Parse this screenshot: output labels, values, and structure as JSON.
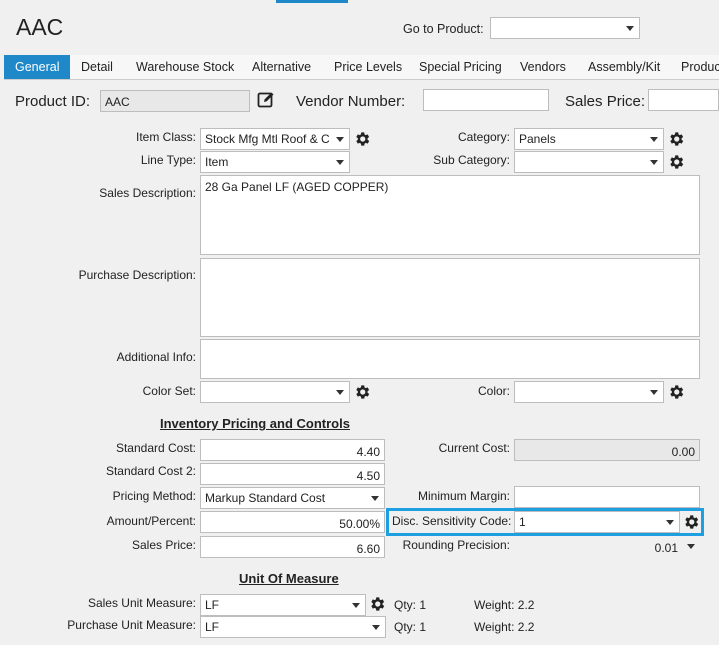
{
  "header": {
    "title": "AAC",
    "goto_label": "Go to Product:",
    "goto_value": ""
  },
  "tabs": [
    "General",
    "Detail",
    "Warehouse Stock",
    "Alternative",
    "Price Levels",
    "Special Pricing",
    "Vendors",
    "Assembly/Kit",
    "Produc"
  ],
  "id_row": {
    "product_id_label": "Product ID:",
    "product_id_value": "AAC",
    "vendor_number_label": "Vendor Number:",
    "vendor_number_value": "",
    "sales_price_label": "Sales Price:",
    "sales_price_value": ""
  },
  "item": {
    "item_class_label": "Item Class:",
    "item_class_value": "Stock Mfg Mtl Roof & C",
    "line_type_label": "Line Type:",
    "line_type_value": "Item",
    "category_label": "Category:",
    "category_value": "Panels",
    "sub_category_label": "Sub Category:",
    "sub_category_value": "",
    "sales_desc_label": "Sales Description:",
    "sales_desc_value": "28 Ga Panel LF (AGED COPPER)",
    "purchase_desc_label": "Purchase Description:",
    "purchase_desc_value": "",
    "additional_info_label": "Additional Info:",
    "additional_info_value": "",
    "color_set_label": "Color Set:",
    "color_set_value": "",
    "color_label": "Color:",
    "color_value": ""
  },
  "pricing": {
    "section_title": "Inventory Pricing and Controls",
    "standard_cost_label": "Standard Cost:",
    "standard_cost_value": "4.40",
    "standard_cost2_label": "Standard Cost 2:",
    "standard_cost2_value": "4.50",
    "pricing_method_label": "Pricing Method:",
    "pricing_method_value": "Markup Standard Cost",
    "amount_percent_label": "Amount/Percent:",
    "amount_percent_value": "50.00%",
    "sales_price_label": "Sales Price:",
    "sales_price_value": "6.60",
    "current_cost_label": "Current Cost:",
    "current_cost_value": "0.00",
    "min_margin_label": "Minimum Margin:",
    "min_margin_value": "",
    "disc_code_label": "Disc. Sensitivity Code:",
    "disc_code_value": "1",
    "rounding_label": "Rounding Precision:",
    "rounding_value": "0.01"
  },
  "uom": {
    "section_title": "Unit Of Measure",
    "sales_uom_label": "Sales Unit Measure:",
    "sales_uom_value": "LF",
    "sales_qty": "Qty: 1",
    "sales_weight": "Weight: 2.2",
    "purchase_uom_label": "Purchase Unit Measure:",
    "purchase_uom_value": "LF",
    "purchase_qty": "Qty: 1",
    "purchase_weight": "Weight: 2.2"
  },
  "colors": {
    "accent": "#1e88c8",
    "highlight": "#1e9fe0"
  }
}
